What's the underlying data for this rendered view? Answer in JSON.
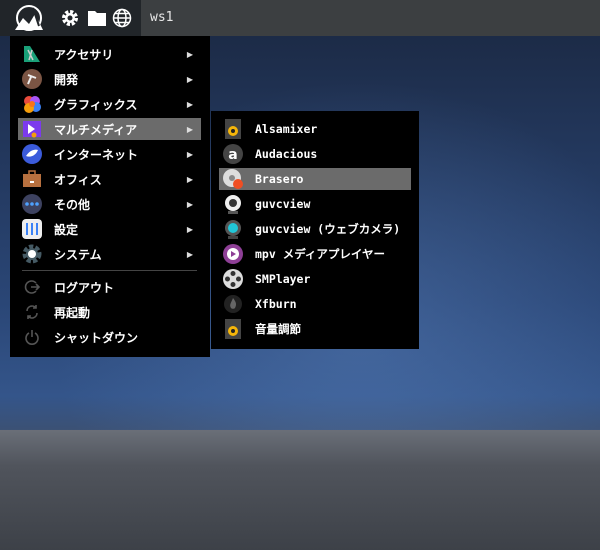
{
  "taskbar": {
    "workspace": "ws1",
    "icons": [
      "logo-icon",
      "gear-icon",
      "folder-icon",
      "globe-icon"
    ]
  },
  "main_menu": {
    "categories": [
      {
        "label": "アクセサリ",
        "icon": "accessories-icon"
      },
      {
        "label": "開発",
        "icon": "development-icon"
      },
      {
        "label": "グラフィックス",
        "icon": "graphics-icon"
      },
      {
        "label": "マルチメディア",
        "icon": "multimedia-icon",
        "selected": true
      },
      {
        "label": "インターネット",
        "icon": "internet-icon"
      },
      {
        "label": "オフィス",
        "icon": "office-icon"
      },
      {
        "label": "その他",
        "icon": "other-icon"
      },
      {
        "label": "設定",
        "icon": "settings-icon"
      },
      {
        "label": "システム",
        "icon": "system-icon"
      }
    ],
    "session": [
      {
        "label": "ログアウト",
        "icon": "logout-icon"
      },
      {
        "label": "再起動",
        "icon": "restart-icon"
      },
      {
        "label": "シャットダウン",
        "icon": "power-icon"
      }
    ],
    "arrow": "▶"
  },
  "multimedia_submenu": {
    "items": [
      {
        "label": "Alsamixer"
      },
      {
        "label": "Audacious"
      },
      {
        "label": "Brasero",
        "selected": true
      },
      {
        "label": "guvcview"
      },
      {
        "label": "guvcview (ウェブカメラ)"
      },
      {
        "label": "mpv メディアプレイヤー"
      },
      {
        "label": "SMPlayer"
      },
      {
        "label": "Xfburn"
      },
      {
        "label": "音量調節"
      }
    ]
  },
  "colors": {
    "highlight": "#6b6b6b",
    "menu_bg": "#000000",
    "taskbar": "#3c3f41"
  }
}
